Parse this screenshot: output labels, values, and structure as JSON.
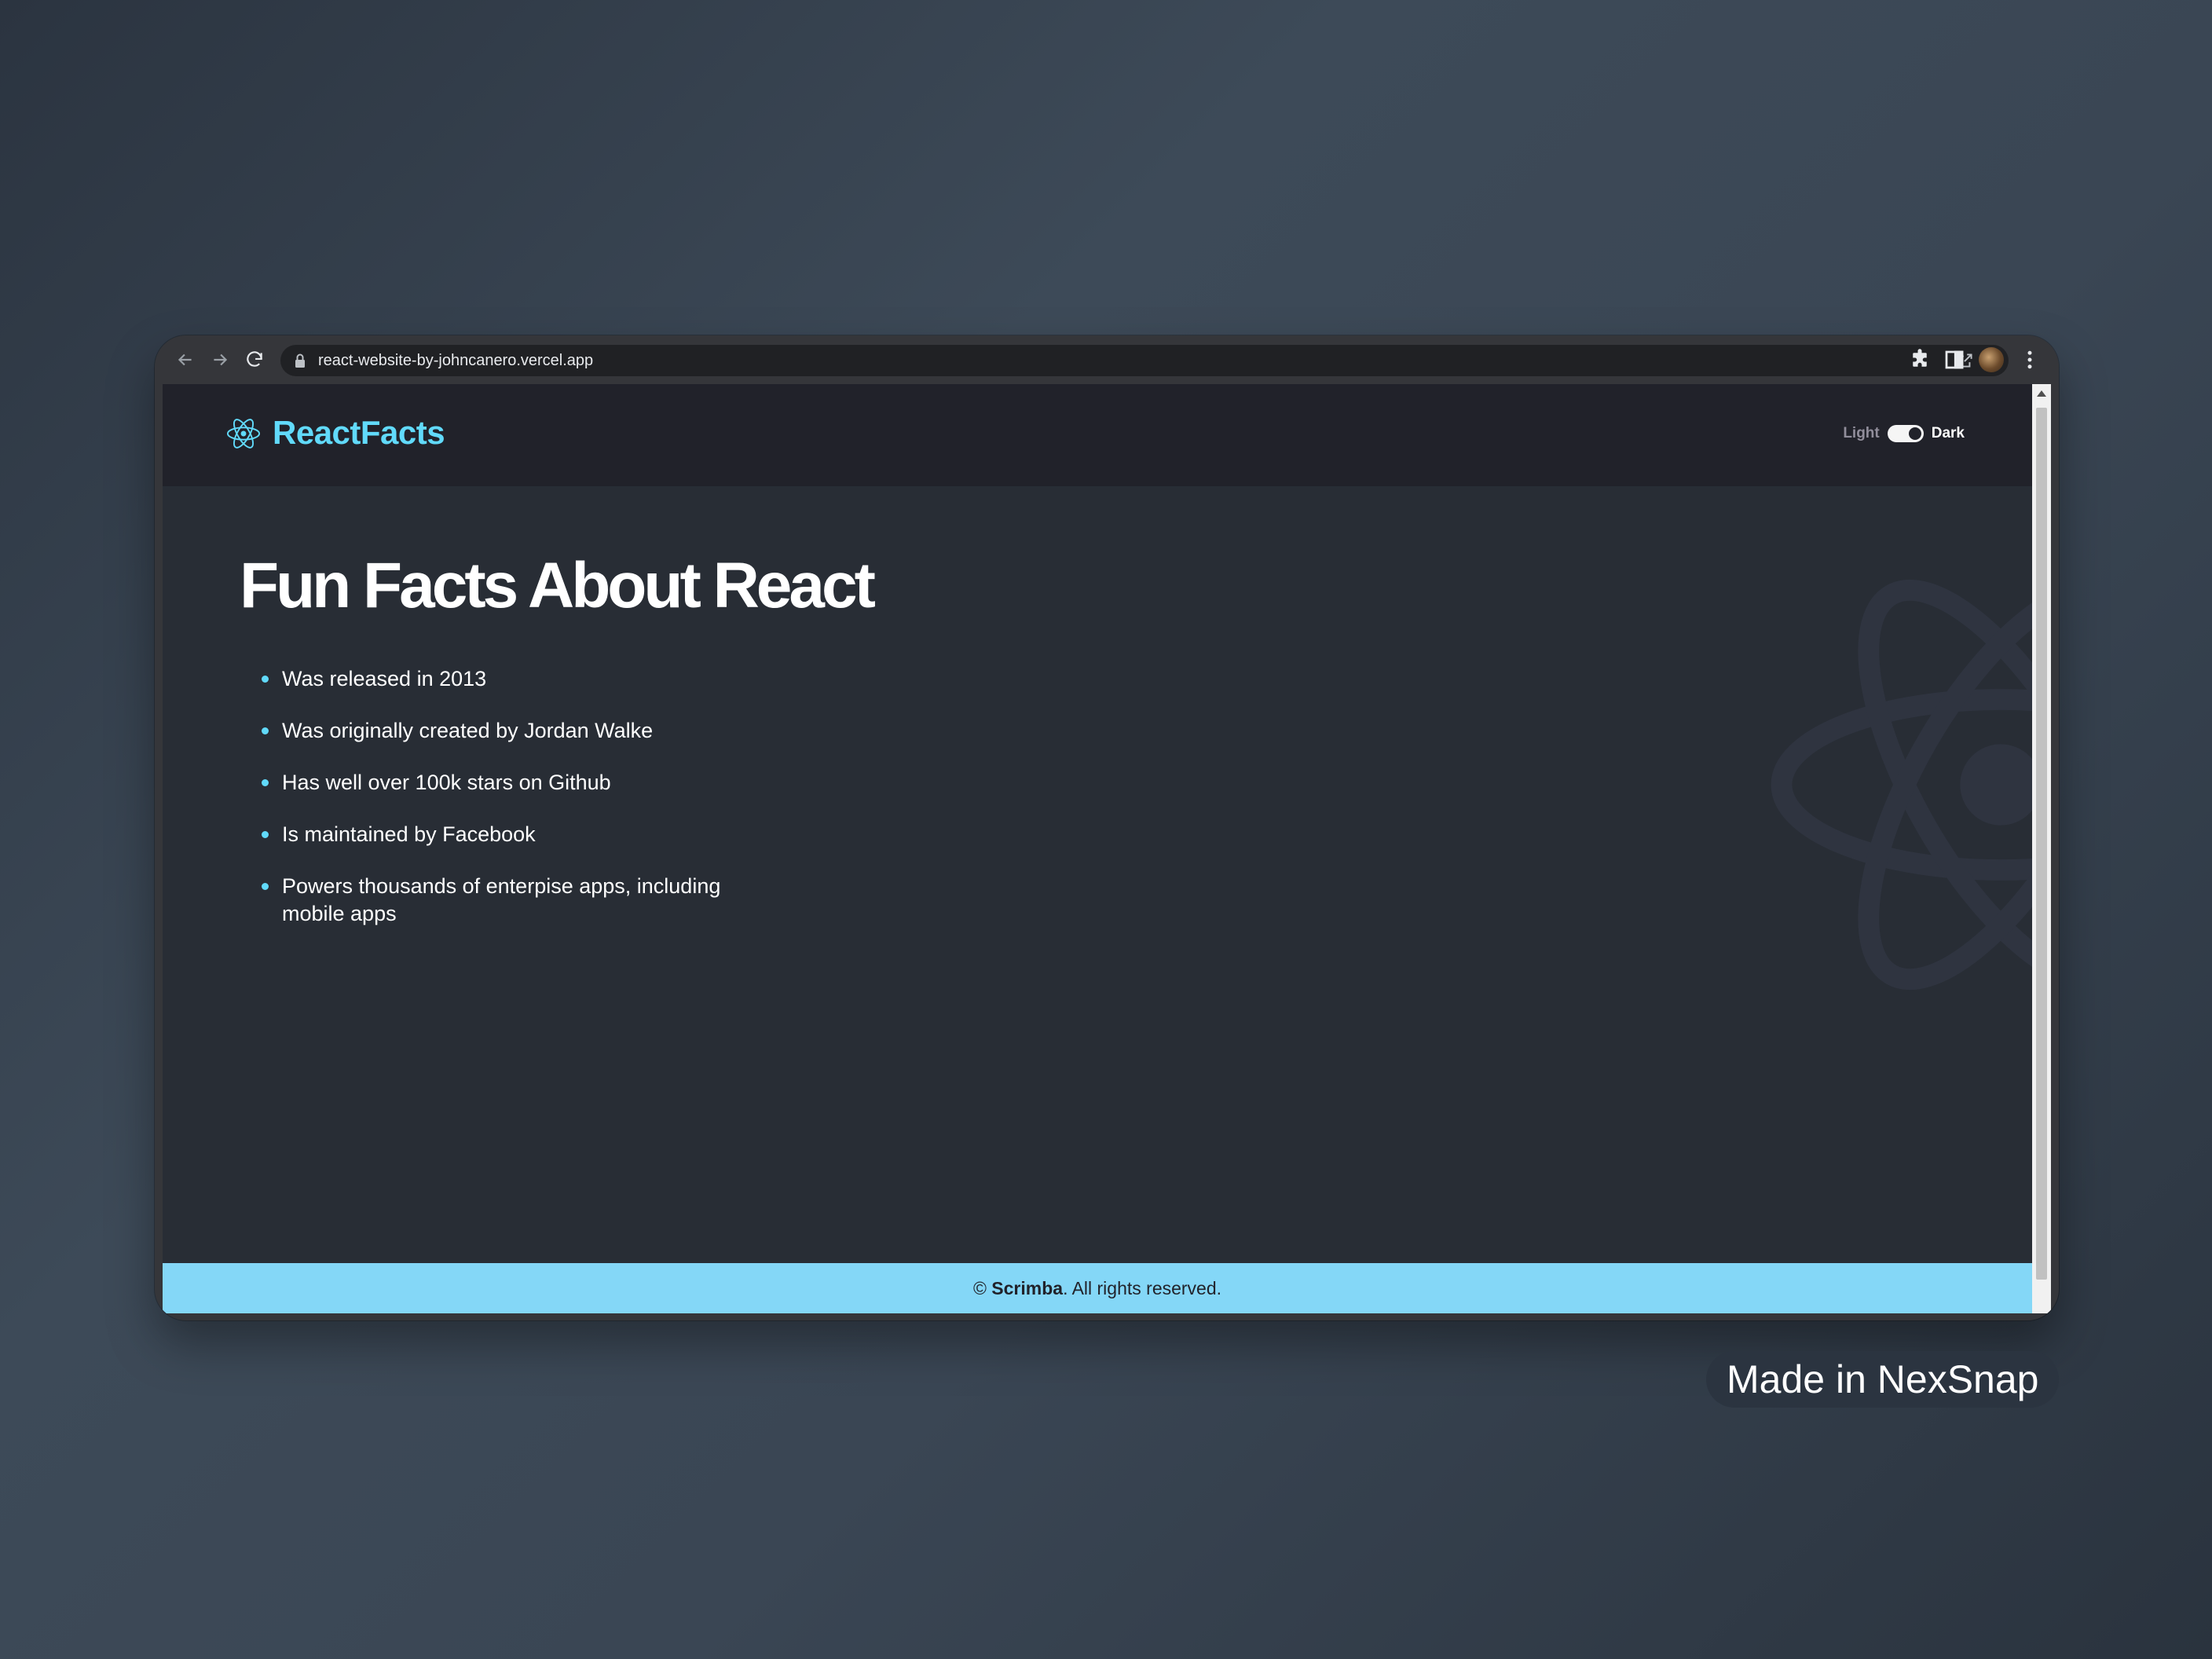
{
  "browser": {
    "url": "react-website-by-johncanero.vercel.app"
  },
  "site": {
    "brand": "ReactFacts",
    "toggle": {
      "light_label": "Light",
      "dark_label": "Dark",
      "mode": "dark"
    },
    "title": "Fun Facts About React",
    "facts": [
      "Was released in 2013",
      "Was originally created by Jordan Walke",
      "Has well over 100k stars on Github",
      "Is maintained by Facebook",
      "Powers thousands of enterpise apps, including mobile apps"
    ],
    "footer": {
      "copyright": "©",
      "company": "Scrimba",
      "rights": ". All rights reserved."
    }
  },
  "badge": {
    "text": "Made in NexSnap"
  },
  "colors": {
    "accent": "#61dafb",
    "nav_bg": "#21222a",
    "page_bg": "#282d35",
    "footer_bg": "#84d7f7"
  },
  "icons": {
    "back": "arrow-left-icon",
    "forward": "arrow-right-icon",
    "reload": "reload-icon",
    "lock": "lock-icon",
    "share": "share-icon",
    "bookmark": "star-icon",
    "extensions": "puzzle-icon",
    "sidepanel": "side-panel-icon",
    "menu": "kebab-menu-icon",
    "logo": "react-logo-icon"
  }
}
